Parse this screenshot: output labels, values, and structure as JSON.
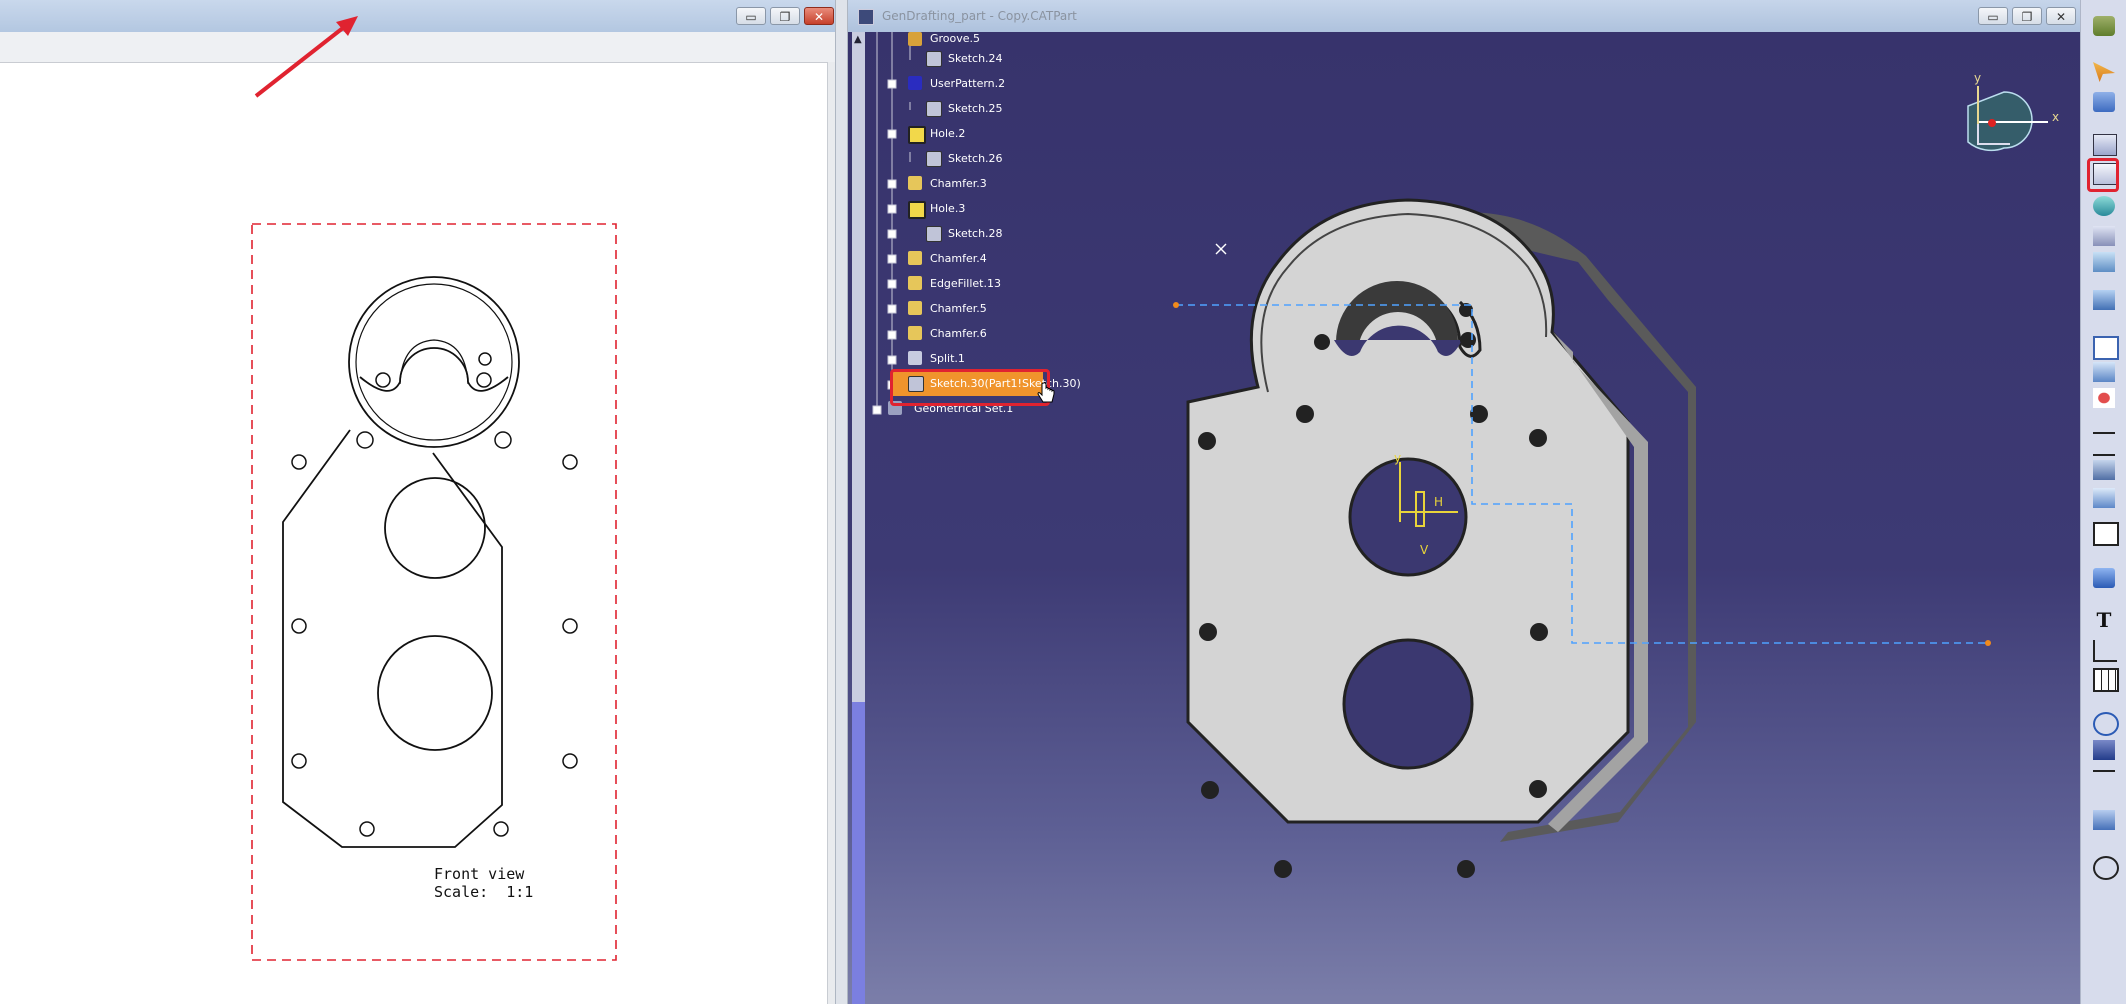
{
  "left_window": {
    "view_caption": "Front view",
    "scale_caption": "Scale:  1:1"
  },
  "right_window": {
    "title": "GenDrafting_part - Copy.CATPart",
    "tree_items": [
      {
        "label": "Groove.5",
        "icon": "groove-icon"
      },
      {
        "label": "Sketch.24",
        "icon": "sketch-icon"
      },
      {
        "label": "UserPattern.2",
        "icon": "user-pattern-icon"
      },
      {
        "label": "Sketch.25",
        "icon": "sketch-icon"
      },
      {
        "label": "Hole.2",
        "icon": "hole-icon"
      },
      {
        "label": "Sketch.26",
        "icon": "sketch-icon"
      },
      {
        "label": "Chamfer.3",
        "icon": "chamfer-icon"
      },
      {
        "label": "Hole.3",
        "icon": "hole-icon"
      },
      {
        "label": "Sketch.28",
        "icon": "sketch-icon"
      },
      {
        "label": "Chamfer.4",
        "icon": "chamfer-icon"
      },
      {
        "label": "EdgeFillet.13",
        "icon": "edge-fillet-icon"
      },
      {
        "label": "Chamfer.5",
        "icon": "chamfer-icon"
      },
      {
        "label": "Chamfer.6",
        "icon": "chamfer-icon"
      },
      {
        "label": "Split.1",
        "icon": "split-icon"
      },
      {
        "label": "Sketch.30(Part1!Sketch.30)",
        "icon": "sketch-icon"
      },
      {
        "label": "Geometrical Set.1",
        "icon": "geometrical-set-icon"
      }
    ],
    "compass": {
      "x_label": "x",
      "y_label": "y"
    },
    "sketch_axes": {
      "h_label": "H",
      "v_label": "V"
    }
  },
  "window_buttons": {
    "minimize": "▭",
    "restore": "❐",
    "close": "✕"
  },
  "colors": {
    "selection": "#f0942c",
    "annotation_red": "#e02330",
    "viewport_top": "#37336c",
    "viewport_bottom": "#7b7ea9",
    "part_face": "#d4d4d4"
  },
  "toolbar": {
    "icons": [
      "select-icon",
      "fly-mode-icon",
      "sketch-icon",
      "drafting-icon",
      "rotate-icon",
      "translate-icon",
      "mirror-icon",
      "grid-icon",
      "rectangle-icon",
      "pattern-icon",
      "snap-icon",
      "dimension-icon",
      "constraint-icon",
      "measure-icon",
      "annotation-icon",
      "analysis-icon",
      "text-icon",
      "check-icon",
      "table-icon",
      "point-icon",
      "axis-icon",
      "projection-icon",
      "layers-icon",
      "compass-icon"
    ]
  }
}
